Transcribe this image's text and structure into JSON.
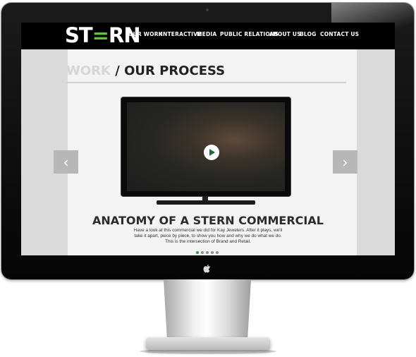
{
  "brand": {
    "logo_prefix": "ST",
    "logo_accent": "=",
    "logo_suffix": "RN"
  },
  "nav": {
    "items": [
      "OUR WORK",
      "INTERACTIVE",
      "MEDIA",
      "PUBLIC RELATIONS",
      "ABOUT US",
      "BLOG",
      "CONTACT US"
    ]
  },
  "page": {
    "breadcrumb_parent": "WORK",
    "breadcrumb_separator": " / ",
    "breadcrumb_current": "OUR PROCESS"
  },
  "slide": {
    "headline": "ANATOMY OF A STERN COMMERCIAL",
    "description_lines": [
      "Have a look at this commercial we did for Kay Jewelers. After it plays, we'll",
      "take it apart, piece by piece, to show you how and why we do what we do.",
      "This is the intersection of Brand and Retail."
    ]
  },
  "carousel": {
    "prev_glyph": "‹",
    "next_glyph": "›",
    "dot_count": 5,
    "active_dot": 0
  },
  "colors": {
    "accent": "#2e9c3e",
    "nav_bg": "#000000",
    "page_bg": "#f3f3f3"
  },
  "icons": [
    "play-icon",
    "chevron-left-icon",
    "chevron-right-icon",
    "apple-icon"
  ]
}
